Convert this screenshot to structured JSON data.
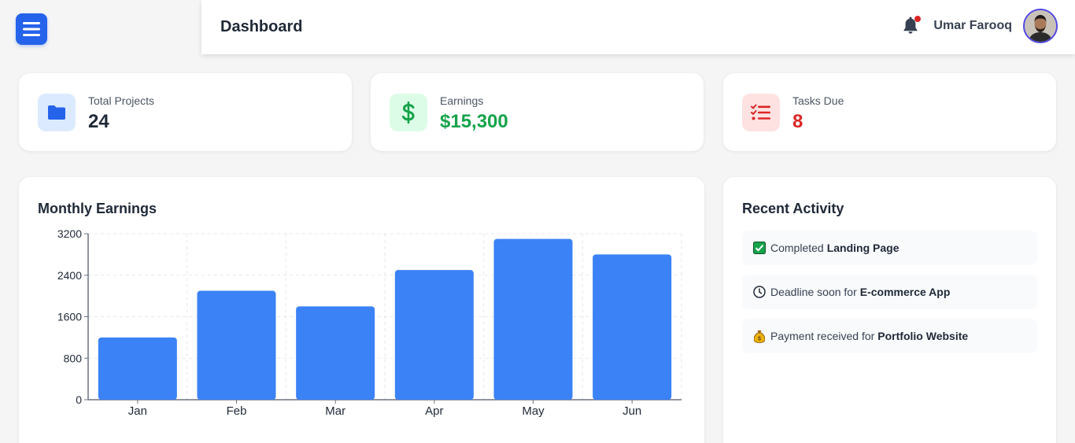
{
  "header": {
    "title": "Dashboard",
    "user_name": "Umar Farooq",
    "has_notification": true
  },
  "stats": [
    {
      "label": "Total Projects",
      "value": "24",
      "icon": "folder-icon",
      "color": "#2563eb",
      "bg": "#dbeafe"
    },
    {
      "label": "Earnings",
      "value": "$15,300",
      "icon": "dollar-icon",
      "color": "#16a34a",
      "bg": "#dcfce7"
    },
    {
      "label": "Tasks Due",
      "value": "8",
      "icon": "task-list-icon",
      "color": "#dc2626",
      "bg": "#fee2e2"
    }
  ],
  "earnings_panel": {
    "title": "Monthly Earnings"
  },
  "activity_panel": {
    "title": "Recent Activity",
    "items": [
      {
        "icon": "check-box-icon",
        "text": "Completed",
        "bold": "Landing Page"
      },
      {
        "icon": "clock-icon",
        "text": "Deadline soon for",
        "bold": "E-commerce App"
      },
      {
        "icon": "money-bag-icon",
        "text": "Payment received for",
        "bold": "Portfolio Website"
      }
    ]
  },
  "chart_data": {
    "type": "bar",
    "categories": [
      "Jan",
      "Feb",
      "Mar",
      "Apr",
      "May",
      "Jun"
    ],
    "values": [
      1200,
      2100,
      1800,
      2500,
      3100,
      2800
    ],
    "yticks": [
      0,
      800,
      1600,
      2400,
      3200
    ],
    "ylim": [
      0,
      3200
    ],
    "grid": true,
    "bar_color": "#3b82f6"
  }
}
